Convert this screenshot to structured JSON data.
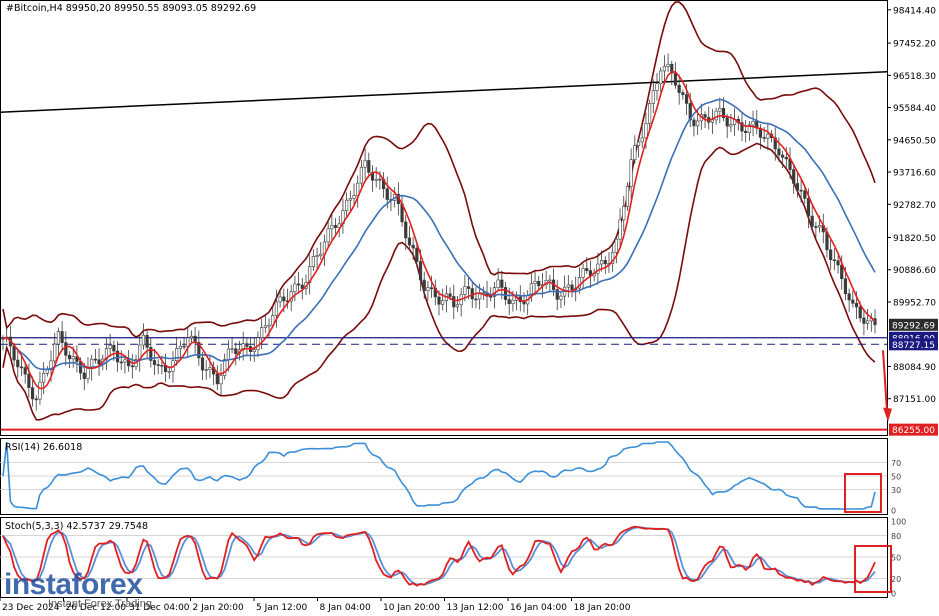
{
  "chart_data": {
    "type": "line",
    "symbol": "#Bitcoin,H4",
    "ohlc_header": "89950,20 89950.55 89093.05 89292.69",
    "price_ticks": [
      "98414.40",
      "97452.20",
      "96518.30",
      "95584.40",
      "94650.50",
      "93716.60",
      "92782.70",
      "91820.50",
      "90886.60",
      "89952.70",
      "88084.90",
      "87151.00"
    ],
    "price_range": [
      86100,
      98700
    ],
    "price_labels": {
      "current": "89292.69",
      "hidden": "88916.00",
      "dashed": "88727.15",
      "support": "86255.00"
    },
    "levels": {
      "current": 89292.69,
      "solid_blue": 88916.0,
      "dashed_blue": 88727.15,
      "support": 86255.0
    },
    "trendline": {
      "from": [
        0,
        95450
      ],
      "to": [
        1,
        96620
      ]
    },
    "x_ticks": [
      "23 Dec 2024",
      "26 Dec 12:00",
      "31 Dec 04:00",
      "2 Jan 20:00",
      "5 Jan 12:00",
      "8 Jan 04:00",
      "10 Jan 20:00",
      "13 Jan 12:00",
      "16 Jan 04:00",
      "18 Jan 20:00"
    ],
    "price_anchors": [
      [
        0,
        88900
      ],
      [
        3,
        88300
      ],
      [
        6,
        87700
      ],
      [
        9,
        87300
      ],
      [
        12,
        88100
      ],
      [
        15,
        88800
      ],
      [
        18,
        88400
      ],
      [
        22,
        88000
      ],
      [
        26,
        88200
      ],
      [
        30,
        88600
      ],
      [
        34,
        88100
      ],
      [
        38,
        88700
      ],
      [
        42,
        88000
      ],
      [
        46,
        88300
      ],
      [
        50,
        88900
      ],
      [
        54,
        88200
      ],
      [
        58,
        87800
      ],
      [
        62,
        88500
      ],
      [
        66,
        88600
      ],
      [
        70,
        89100
      ],
      [
        74,
        89700
      ],
      [
        78,
        90300
      ],
      [
        82,
        90700
      ],
      [
        86,
        91400
      ],
      [
        90,
        92300
      ],
      [
        94,
        93000
      ],
      [
        98,
        93800
      ],
      [
        102,
        93400
      ],
      [
        106,
        93000
      ],
      [
        110,
        91500
      ],
      [
        114,
        90500
      ],
      [
        118,
        90100
      ],
      [
        122,
        89800
      ],
      [
        126,
        90400
      ],
      [
        130,
        90100
      ],
      [
        134,
        90300
      ],
      [
        138,
        90000
      ],
      [
        142,
        90200
      ],
      [
        146,
        90500
      ],
      [
        150,
        90300
      ],
      [
        154,
        90400
      ],
      [
        158,
        90700
      ],
      [
        162,
        91100
      ],
      [
        166,
        91600
      ],
      [
        170,
        93900
      ],
      [
        174,
        95300
      ],
      [
        178,
        96800
      ],
      [
        182,
        96300
      ],
      [
        186,
        95400
      ],
      [
        190,
        95200
      ],
      [
        194,
        95300
      ],
      [
        198,
        95200
      ],
      [
        202,
        95000
      ],
      [
        206,
        94700
      ],
      [
        210,
        94500
      ],
      [
        214,
        93500
      ],
      [
        218,
        92400
      ],
      [
        222,
        92000
      ],
      [
        226,
        90800
      ],
      [
        230,
        89700
      ],
      [
        233,
        89600
      ],
      [
        236,
        89300
      ]
    ],
    "rsi": {
      "label": "RSI(14) 26.6018",
      "value": 26.6018,
      "ticks": [
        "70",
        "50",
        "30",
        "0"
      ],
      "range": [
        0,
        100
      ]
    },
    "stoch": {
      "label": "Stoch(5,3,3) 42.5737 29.7548",
      "k": 42.5737,
      "d": 29.7548,
      "ticks": [
        "100",
        "80",
        "50",
        "20",
        "0"
      ],
      "range": [
        0,
        100
      ]
    },
    "colors": {
      "candle": "#3a3a3a",
      "ma_fast": "#e02020",
      "ma_slow": "#3b6fb6",
      "bands": "#7a0a0a",
      "level_blue": "#1a1a80",
      "support": "#e02020",
      "rsi_line": "#3b8fd9",
      "stoch_k": "#e02020",
      "stoch_d": "#5b8fd9",
      "highlight_box": "#e02020",
      "arrow": "#e02020",
      "current_label_bg": "#2b2b2b",
      "level_label_bg": "#1a1a80",
      "support_label_bg": "#e02020"
    }
  },
  "watermark": {
    "logo": "instaforex",
    "tagline": "Instant Forex Trading"
  }
}
